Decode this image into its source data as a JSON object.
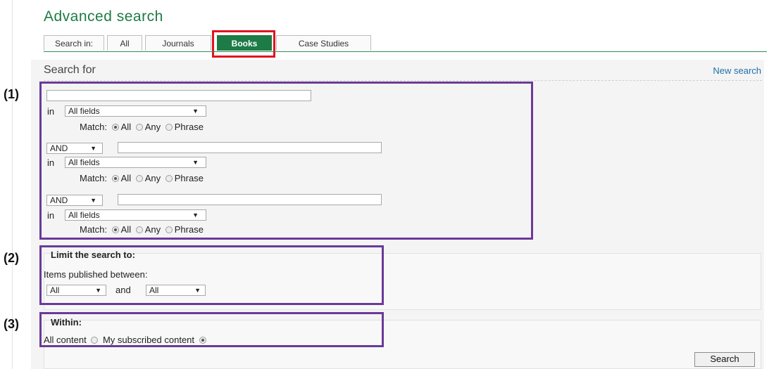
{
  "page": {
    "title": "Advanced search",
    "search_in_label": "Search in:"
  },
  "tabs": [
    {
      "label": "All"
    },
    {
      "label": "Journals"
    },
    {
      "label": "Books"
    },
    {
      "label": "Case Studies"
    }
  ],
  "search_for": {
    "heading": "Search for",
    "new_search": "New search"
  },
  "rows": [
    {
      "operator": "",
      "term": "",
      "in_label": "in",
      "field": "All fields",
      "match_label": "Match:",
      "match_options": [
        "All",
        "Any",
        "Phrase"
      ],
      "match_selected": "All"
    },
    {
      "operator": "AND",
      "term": "",
      "in_label": "in",
      "field": "All fields",
      "match_label": "Match:",
      "match_options": [
        "All",
        "Any",
        "Phrase"
      ],
      "match_selected": "All"
    },
    {
      "operator": "AND",
      "term": "",
      "in_label": "in",
      "field": "All fields",
      "match_label": "Match:",
      "match_options": [
        "All",
        "Any",
        "Phrase"
      ],
      "match_selected": "All"
    }
  ],
  "limit": {
    "heading": "Limit the search to:",
    "label": "Items published between:",
    "from": "All",
    "and_label": "and",
    "to": "All"
  },
  "within": {
    "heading": "Within:",
    "options": [
      "All content",
      "My subscribed content"
    ],
    "selected": "My subscribed content"
  },
  "search_button": "Search",
  "annotations": [
    "(1)",
    "(2)",
    "(3)"
  ],
  "colors": {
    "brand_green": "#1d7b46",
    "highlight_red": "#e0141e",
    "annotation_purple": "#6a3a99",
    "link_blue": "#1e6fa8"
  }
}
